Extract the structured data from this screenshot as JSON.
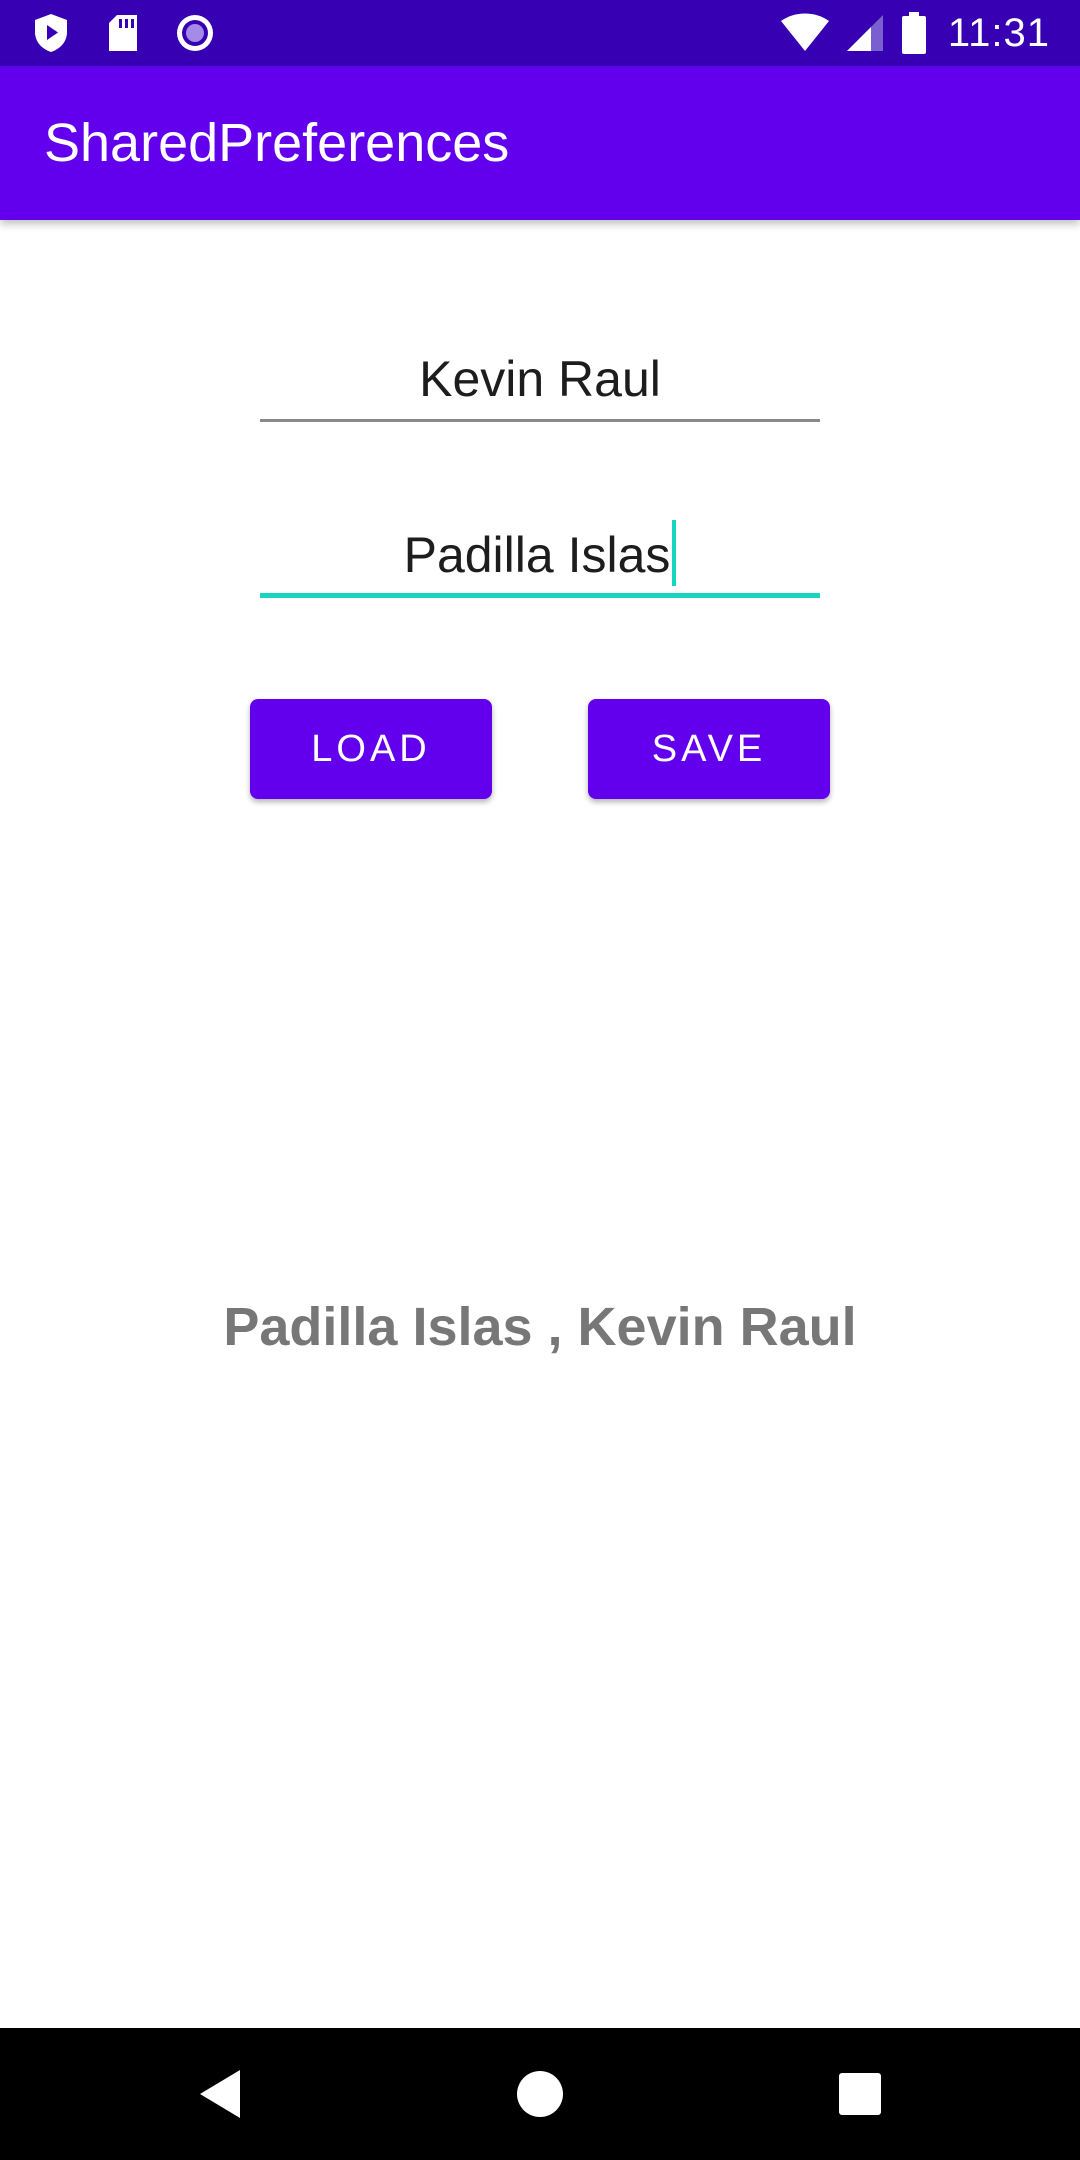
{
  "status_bar": {
    "time": "11:31",
    "left_icons": [
      "shield-play-icon",
      "sd-card-icon",
      "record-icon"
    ],
    "right_icons": [
      "wifi-icon",
      "cellular-signal-icon",
      "battery-icon"
    ],
    "background": "#3700b3"
  },
  "app_bar": {
    "title": "SharedPreferences",
    "background": "#6200ee"
  },
  "form": {
    "first_name_value": "Kevin Raul",
    "last_name_value": "Padilla Islas",
    "focus_color": "#1ad4c3"
  },
  "buttons": {
    "load_label": "LOAD",
    "save_label": "SAVE",
    "color": "#6200ee"
  },
  "result": {
    "text": "Padilla Islas , Kevin Raul"
  },
  "nav_bar": {
    "icons": [
      "back-icon",
      "home-icon",
      "recents-icon"
    ]
  }
}
